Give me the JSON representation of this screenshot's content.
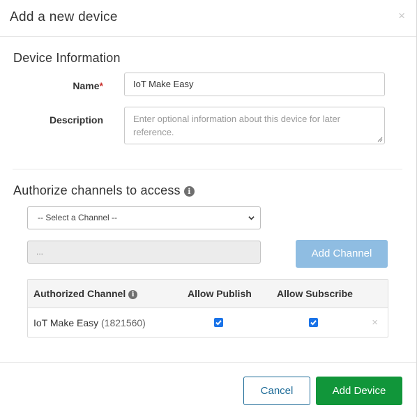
{
  "modal": {
    "title": "Add a new device",
    "close_glyph": "×"
  },
  "device_info": {
    "section_title": "Device Information",
    "name_label": "Name",
    "required_mark": "*",
    "name_value": "IoT Make Easy",
    "description_label": "Description",
    "description_placeholder": "Enter optional information about this device for later reference."
  },
  "channels": {
    "section_title": "Authorize channels to access",
    "info_icon": "info-icon",
    "select_selected": "-- Select a Channel --",
    "channel_input_value": "...",
    "add_channel_label": "Add Channel",
    "table": {
      "headers": [
        "Authorized Channel",
        "Allow Publish",
        "Allow Subscribe"
      ],
      "rows": [
        {
          "channel_name": "IoT Make Easy",
          "channel_id": "(1821560)",
          "allow_publish": true,
          "allow_subscribe": true,
          "remove_glyph": "×"
        }
      ]
    }
  },
  "footer": {
    "cancel_label": "Cancel",
    "add_device_label": "Add Device"
  },
  "colors": {
    "primary_blue_disabled": "#8fbde2",
    "success_green": "#11963a",
    "cancel_border": "#1c6a97",
    "checkbox_blue": "#1a73e8",
    "required_red": "#c9302c"
  }
}
